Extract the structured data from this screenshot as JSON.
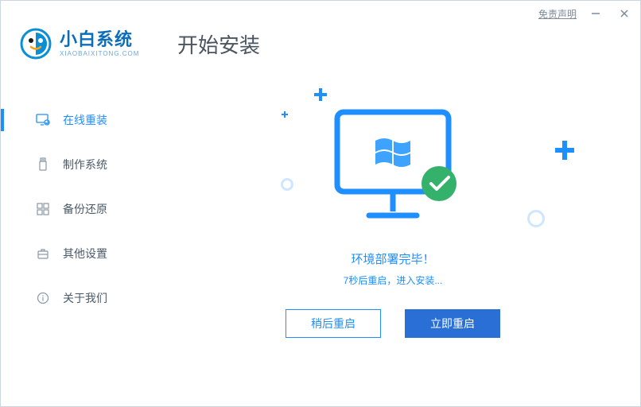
{
  "titlebar": {
    "disclaimer": "免责声明"
  },
  "brand": {
    "name_cn": "小白系统",
    "name_en": "XIAOBAIXITONG.COM"
  },
  "sidebar": {
    "items": [
      {
        "label": "在线重装"
      },
      {
        "label": "制作系统"
      },
      {
        "label": "备份还原"
      },
      {
        "label": "其他设置"
      },
      {
        "label": "关于我们"
      }
    ]
  },
  "main": {
    "title": "开始安装",
    "status_title": "环境部署完毕！",
    "status_sub": "7秒后重启，进入安装..."
  },
  "actions": {
    "later": "稍后重启",
    "now": "立即重启"
  }
}
